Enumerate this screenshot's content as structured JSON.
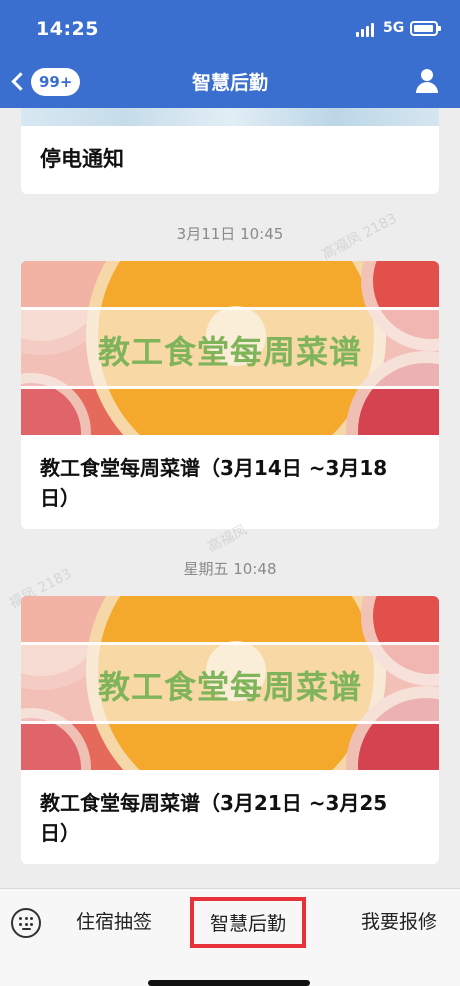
{
  "status_bar": {
    "time": "14:25",
    "network": "5G"
  },
  "nav": {
    "badge": "99+",
    "title": "智慧后勤"
  },
  "feed": {
    "notice_card": {
      "title": "停电通知"
    },
    "items": [
      {
        "timestamp": "3月11日 10:45",
        "banner_text": "教工食堂每周菜谱",
        "caption_line1": "教工食堂每周菜谱（3月14日 ~3月18",
        "caption_line2": "日）"
      },
      {
        "timestamp": "星期五 10:48",
        "banner_text": "教工食堂每周菜谱",
        "caption_line1": "教工食堂每周菜谱（3月21日 ~3月25",
        "caption_line2": "日）"
      }
    ],
    "watermarks": [
      "高福凤 2183",
      "高福凤",
      "福凤 2183"
    ]
  },
  "bottom_menu": {
    "items": [
      {
        "label": "住宿抽签"
      },
      {
        "label": "智慧后勤",
        "active": true
      },
      {
        "label": "我要报修"
      }
    ]
  },
  "colors": {
    "header": "#3a6fd0",
    "active_border": "#e8323a",
    "banner_text": "#7fb45a"
  },
  "icons": [
    "back-chevron-icon",
    "user-icon",
    "keyboard-icon",
    "battery-icon",
    "signal-icon"
  ]
}
